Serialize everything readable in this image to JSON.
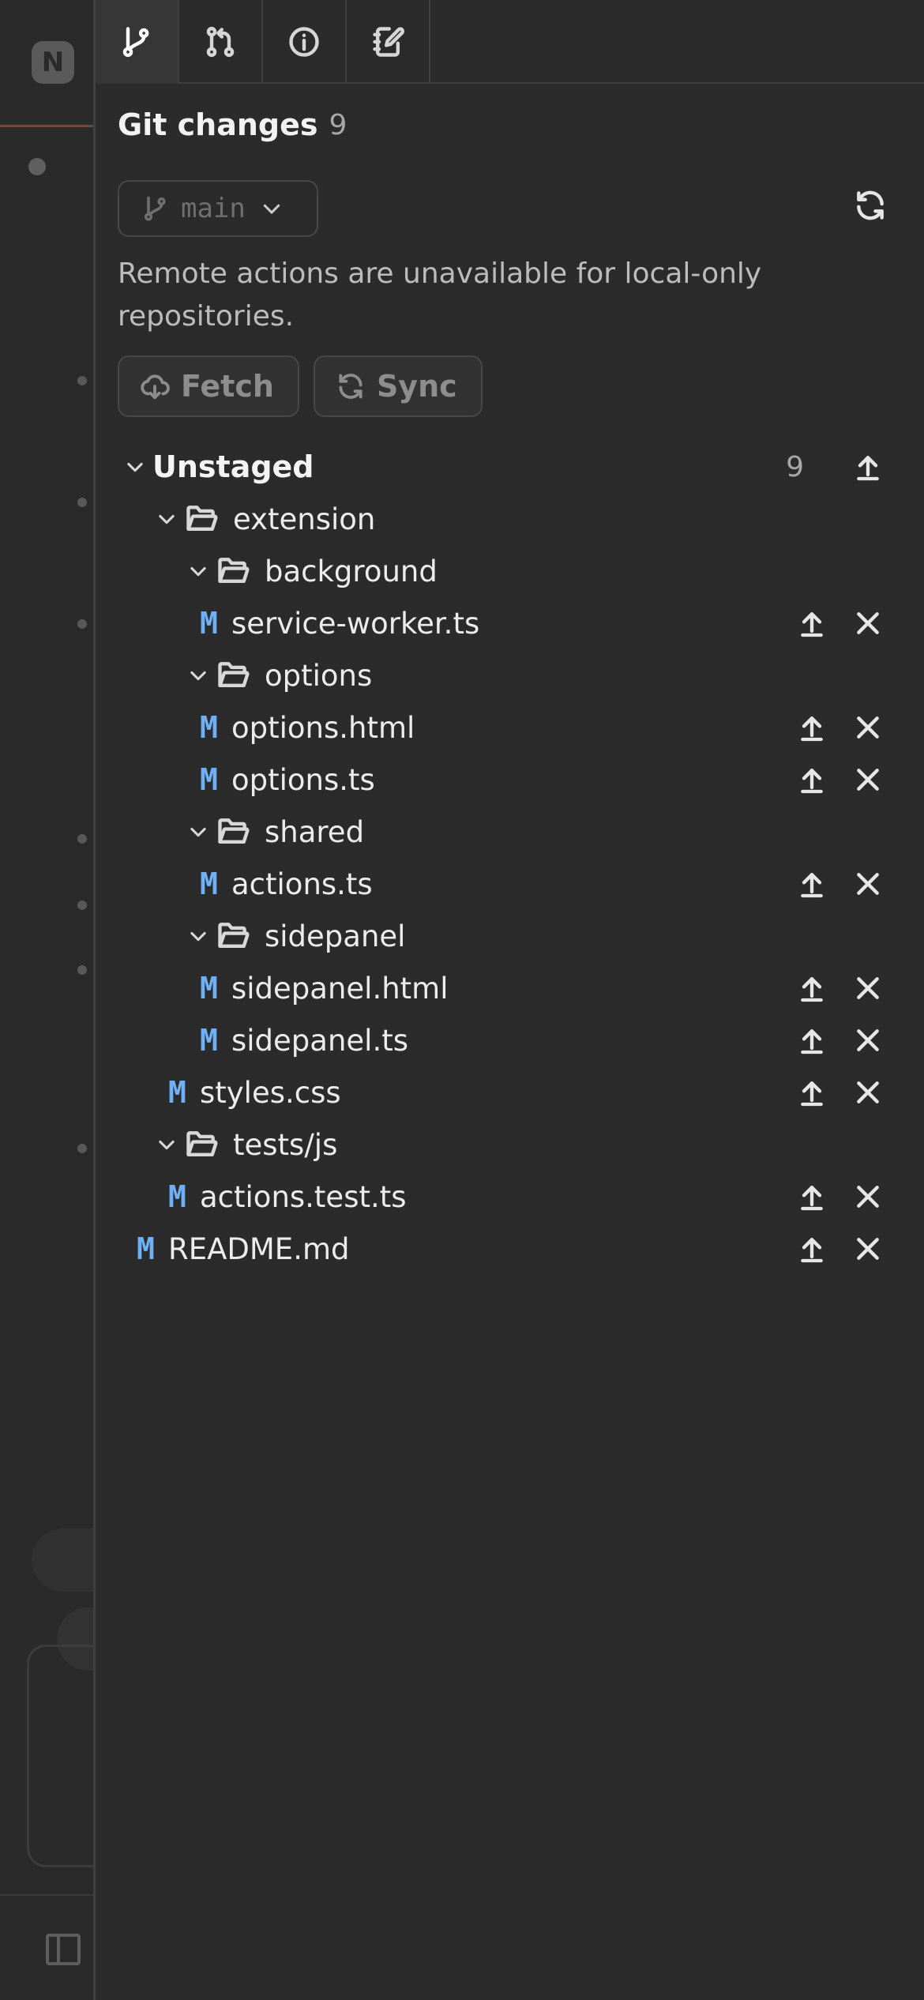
{
  "background": {
    "logo": "N"
  },
  "tabs": [
    {
      "name": "tab-git-changes",
      "icon": "git-branch-icon",
      "active": true
    },
    {
      "name": "tab-pull-requests",
      "icon": "git-pull-request-icon",
      "active": false
    },
    {
      "name": "tab-info",
      "icon": "info-icon",
      "active": false
    },
    {
      "name": "tab-notes",
      "icon": "notebook-edit-icon",
      "active": false
    }
  ],
  "panel": {
    "title": "Git changes",
    "count": "9",
    "branch": "main",
    "notice": "Remote actions are unavailable for local-only repositories.",
    "fetch_label": "Fetch",
    "sync_label": "Sync"
  },
  "tree": {
    "section_label": "Unstaged",
    "section_count": "9",
    "status_mark": "M",
    "rows": [
      {
        "type": "folder",
        "label": "extension"
      },
      {
        "type": "folder",
        "label": "background"
      },
      {
        "type": "file",
        "label": "service-worker.ts"
      },
      {
        "type": "folder",
        "label": "options"
      },
      {
        "type": "file",
        "label": "options.html"
      },
      {
        "type": "file",
        "label": "options.ts"
      },
      {
        "type": "folder",
        "label": "shared"
      },
      {
        "type": "file",
        "label": "actions.ts"
      },
      {
        "type": "folder",
        "label": "sidepanel"
      },
      {
        "type": "file",
        "label": "sidepanel.html"
      },
      {
        "type": "file",
        "label": "sidepanel.ts"
      },
      {
        "type": "file",
        "label": "styles.css"
      },
      {
        "type": "folder",
        "label": "tests/js"
      },
      {
        "type": "file",
        "label": "actions.test.ts"
      },
      {
        "type": "file",
        "label": "README.md"
      }
    ]
  }
}
